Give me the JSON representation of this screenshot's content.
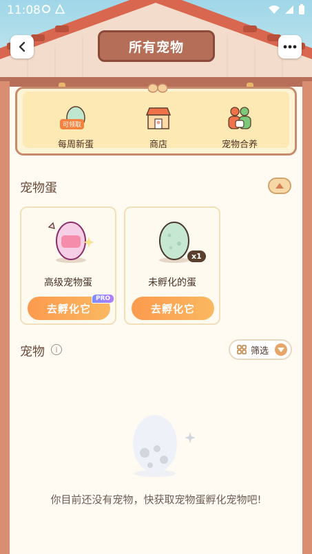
{
  "status": {
    "time": "11:08"
  },
  "header": {
    "title": "所有宠物"
  },
  "shelf": {
    "items": [
      {
        "label": "每周新蛋",
        "badge": "可领取"
      },
      {
        "label": "商店"
      },
      {
        "label": "宠物合养"
      }
    ]
  },
  "eggs_section": {
    "title": "宠物蛋",
    "cards": [
      {
        "name": "高级宠物蛋",
        "button": "去孵化它",
        "badge": "PRO"
      },
      {
        "name": "未孵化的蛋",
        "button": "去孵化它",
        "count": "x1"
      }
    ]
  },
  "pets_section": {
    "title": "宠物",
    "filter_label": "筛选",
    "empty_message": "你目前还没有宠物，快获取宠物蛋孵化宠物吧!"
  },
  "colors": {
    "accent": "#fb9a4e",
    "roof": "#b56e58",
    "pro": "#8c7cff"
  }
}
